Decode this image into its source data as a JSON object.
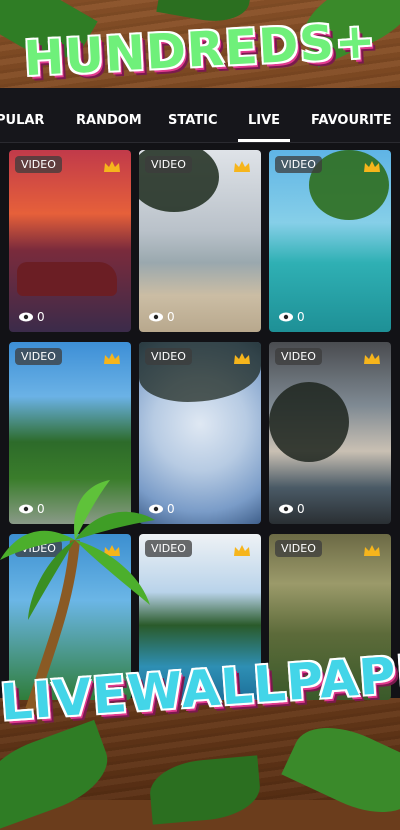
{
  "brand": {
    "top": "HUNDREDS+",
    "bottom": "LIVEWALLPAPER"
  },
  "tabs": [
    {
      "label": "PULAR",
      "active": false
    },
    {
      "label": "RANDOM",
      "active": false
    },
    {
      "label": "STATIC",
      "active": false
    },
    {
      "label": "LIVE",
      "active": true
    },
    {
      "label": "FAVOURITE",
      "active": false
    }
  ],
  "wallpapers": [
    {
      "badge": "VIDEO",
      "views": "0",
      "premium": true
    },
    {
      "badge": "VIDEO",
      "views": "0",
      "premium": true
    },
    {
      "badge": "VIDEO",
      "views": "0",
      "premium": true
    },
    {
      "badge": "VIDEO",
      "views": "0",
      "premium": true
    },
    {
      "badge": "VIDEO",
      "views": "0",
      "premium": true
    },
    {
      "badge": "VIDEO",
      "views": "0",
      "premium": true
    },
    {
      "badge": "VIDEO",
      "views": "",
      "premium": true
    },
    {
      "badge": "VIDEO",
      "views": "",
      "premium": true
    },
    {
      "badge": "VIDEO",
      "views": "",
      "premium": true
    }
  ],
  "icons": {
    "premium": "crown-icon",
    "views": "eye-icon"
  },
  "colors": {
    "accent": "#ffffff",
    "crown": "#f6b51c",
    "app_bg": "#121216"
  }
}
